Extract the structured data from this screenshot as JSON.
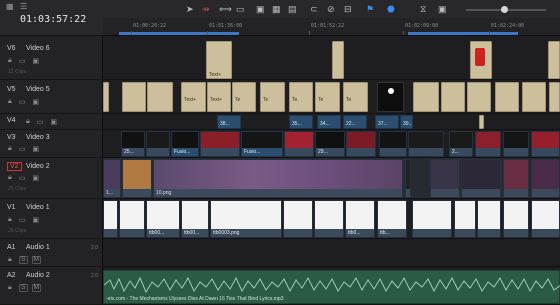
{
  "toolbar": {
    "timecode": "01:03:57:22",
    "icons": [
      "grid-icon",
      "list-icon",
      "sliders-icon"
    ],
    "buttons": [
      {
        "name": "selection-mode-icon",
        "glyph": "➤"
      },
      {
        "name": "trim-mode-icon",
        "glyph": "⇸"
      },
      {
        "name": "dynamic-trim-icon",
        "glyph": "⟺"
      },
      {
        "name": "blade-icon",
        "glyph": "▭"
      },
      {
        "name": "insert-clip-icon",
        "glyph": "▣"
      },
      {
        "name": "overwrite-clip-icon",
        "glyph": "▦"
      },
      {
        "name": "replace-clip-icon",
        "glyph": "▤"
      },
      {
        "name": "snapping-icon",
        "glyph": "⊂"
      },
      {
        "name": "link-icon",
        "glyph": "⊘"
      },
      {
        "name": "position-lock-icon",
        "glyph": "⊟"
      },
      {
        "name": "flag-icon",
        "glyph": "⚑"
      },
      {
        "name": "marker-icon",
        "glyph": "⬣"
      },
      {
        "name": "zoom-out-icon",
        "glyph": "⧖"
      },
      {
        "name": "zoom-fit-icon",
        "glyph": "▣"
      }
    ]
  },
  "ruler": {
    "ticks": [
      "01:00:20:22",
      "01:01:36:00",
      "01:01:52:22",
      "01:02:09:00",
      "01:02:24:00"
    ]
  },
  "tracks": [
    {
      "id": "V6",
      "name": "Video 6",
      "clips_count": "12 Clips"
    },
    {
      "id": "V5",
      "name": "Video 5",
      "clips_count": ""
    },
    {
      "id": "V4",
      "name": "",
      "clips_count": ""
    },
    {
      "id": "V3",
      "name": "Video 3",
      "clips_count": ""
    },
    {
      "id": "V2",
      "name": "Video 2",
      "clips_count": "25 Clips"
    },
    {
      "id": "V1",
      "name": "Video 1",
      "clips_count": "25 Clips"
    },
    {
      "id": "A1",
      "name": "Audio 1",
      "volume": "2.0"
    },
    {
      "id": "A2",
      "name": "Audio 2",
      "volume": "2.0"
    }
  ],
  "lanes": {
    "v6": {
      "clip_label": "Text+"
    },
    "v5": {
      "clip_label": "Text+",
      "clip_label_short": "Te"
    },
    "v4": {
      "clip_labels": [
        "38...",
        "35...",
        "34...",
        "22...",
        "37...",
        "39..."
      ]
    },
    "v3": {
      "clip_labels": [
        "25...",
        "Fusio...",
        "Fusio...",
        "29...",
        "2..."
      ]
    },
    "v2": {
      "clip_labels": [
        "1...",
        "10.png"
      ]
    },
    "v1": {
      "clip_labels": [
        "ttb00...",
        "ttb00...",
        "ttb0003.png",
        "ttb0...",
        "ttb..."
      ]
    },
    "a2": {
      "clip_label": "-ets.com - The Mechanisms  Ulysses Dies At Dawn  16  Ties That Bind Lyrics.mp3"
    }
  },
  "buttons_audio": {
    "solo": "S",
    "mute": "M"
  },
  "colors": {
    "accent": "#3b8cf0",
    "playhead": "#e33333",
    "text_clip": "#cdbf9c",
    "fusion_clip": "#2b4e6e",
    "audio_clip": "#2b5a45"
  }
}
